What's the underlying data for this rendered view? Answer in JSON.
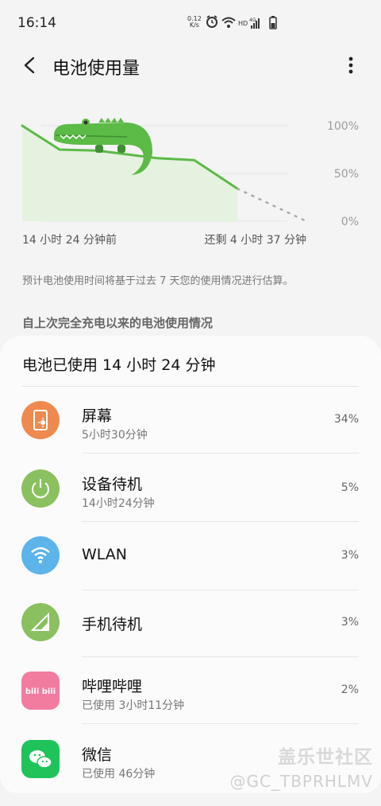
{
  "status": {
    "time": "16:14",
    "speed_value": "0.12",
    "speed_unit": "K/s",
    "icons": [
      "alarm-icon",
      "wifi-icon",
      "hd-icon",
      "4g-signal-icon",
      "battery-icon"
    ]
  },
  "header": {
    "title": "电池使用量",
    "back_icon": "back-arrow-icon",
    "more_icon": "more-vertical-icon"
  },
  "chart_data": {
    "type": "area",
    "y_ticks": [
      "100%",
      "50%",
      "0%"
    ],
    "ylim": [
      0,
      100
    ],
    "actual_series": {
      "x_hours": [
        0,
        2.5,
        5,
        7,
        9,
        11.5,
        14.4
      ],
      "y_percent": [
        100,
        75,
        74,
        70,
        66,
        64,
        34
      ]
    },
    "projected_series": {
      "x_hours": [
        14.4,
        19.0
      ],
      "y_percent": [
        34,
        0
      ]
    },
    "x_start_label": "14 小时 24 分钟前",
    "x_end_label": "还剩 4 小时 37 分钟",
    "colors": {
      "line": "#5cba47",
      "fill": "#e6f2e0",
      "projection": "#aaaaaa"
    }
  },
  "note": "预计电池使用时间将基于过去 7 天您的使用情况进行估算。",
  "section_header": "自上次完全充电以来的电池使用情况",
  "usage": {
    "title": "电池已使用 14 小时 24 分钟",
    "items": [
      {
        "name": "屏幕",
        "sub": "5小时30分钟",
        "percent": "34%",
        "icon": "screen-brightness-icon",
        "color": "#ef8a4f"
      },
      {
        "name": "设备待机",
        "sub": "14小时24分钟",
        "percent": "5%",
        "icon": "power-icon",
        "color": "#8bc060"
      },
      {
        "name": "WLAN",
        "sub": "",
        "percent": "3%",
        "icon": "wifi-icon",
        "color": "#5cb4ea"
      },
      {
        "name": "手机待机",
        "sub": "",
        "percent": "3%",
        "icon": "cell-signal-icon",
        "color": "#8bc060"
      },
      {
        "name": "哔哩哔哩",
        "sub": "已使用 3小时11分钟",
        "percent": "2%",
        "icon": "bilibili-app-icon",
        "color": "#f27ba0",
        "icon_text": "bili bili"
      },
      {
        "name": "微信",
        "sub": "已使用 46分钟",
        "percent": "",
        "icon": "wechat-app-icon",
        "color": "#1fc35a"
      }
    ]
  },
  "watermark": {
    "line1": "盖乐世社区",
    "line2": "@GC_TBPRHLMV"
  }
}
